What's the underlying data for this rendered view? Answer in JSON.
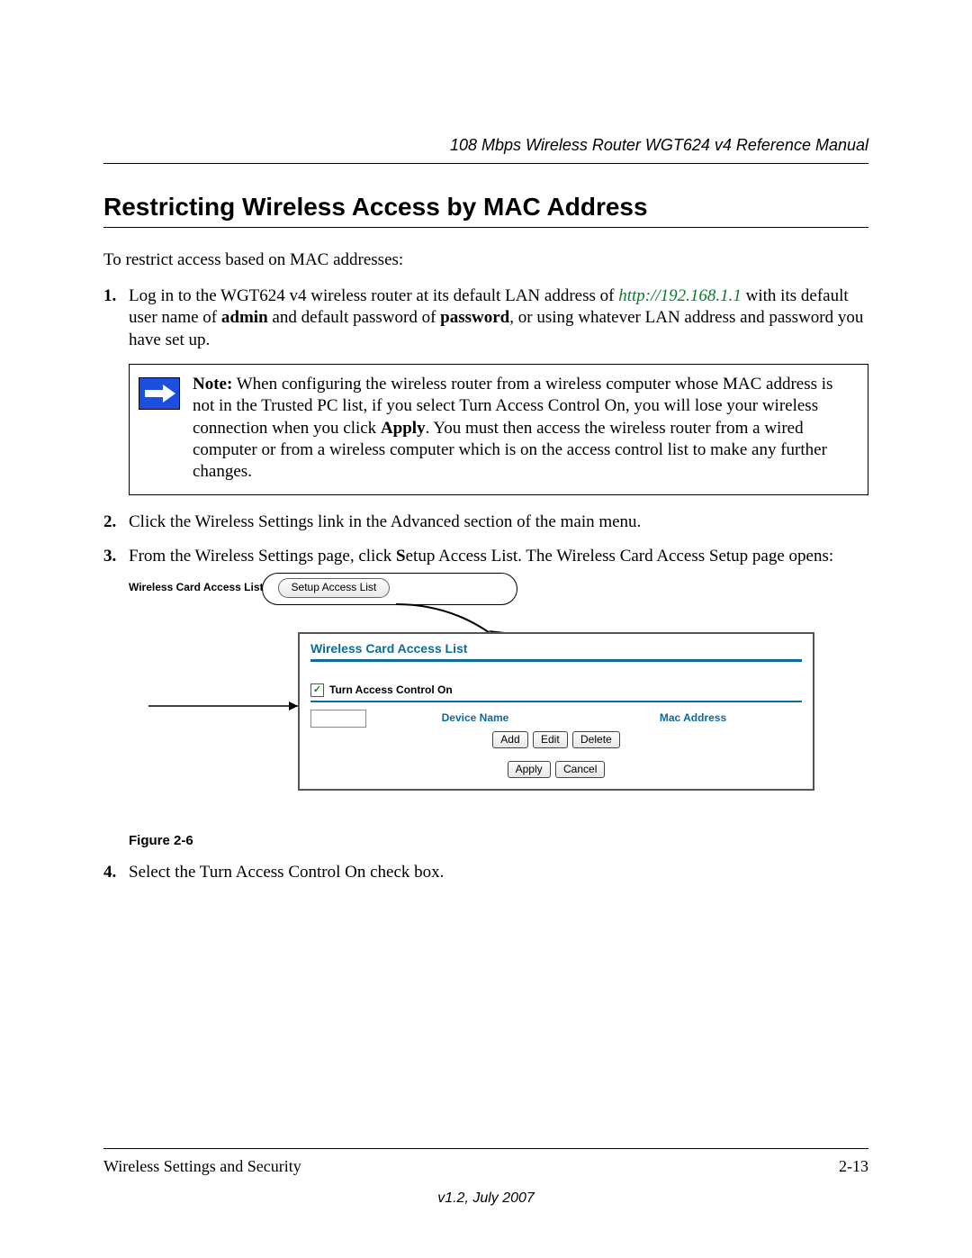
{
  "header": {
    "running_head": "108 Mbps Wireless Router WGT624 v4 Reference Manual"
  },
  "section": {
    "title": "Restricting Wireless Access by MAC Address",
    "intro": "To restrict access based on MAC addresses:"
  },
  "steps": {
    "s1": {
      "num": "1.",
      "pre": "Log in to the WGT624 v4 wireless router at its default LAN address of ",
      "link_text": "http://192.168.1.1",
      "mid1": " with its default user name of ",
      "bold1": "admin",
      "mid2": " and default password of ",
      "bold2": "password",
      "post": ", or using whatever LAN address and password you have set up."
    },
    "note": {
      "label": "Note:",
      "body_a": " When configuring the wireless router from a wireless computer whose MAC address is not in the Trusted PC list, if you select Turn Access Control On, you will lose your wireless connection when you click ",
      "apply": "Apply",
      "body_b": ". You must then access the wireless router from a wired computer or from a wireless computer which is on the access control list to make any further changes."
    },
    "s2": {
      "num": "2.",
      "text": "Click the Wireless Settings link in the Advanced section of the main menu."
    },
    "s3": {
      "num": "3.",
      "pre": "From the Wireless Settings page, click ",
      "bold_s": "S",
      "post": "etup Access List. The Wireless Card Access Setup page opens:"
    },
    "s4": {
      "num": "4.",
      "text": "Select the Turn Access Control On check box."
    }
  },
  "figure": {
    "top_label": "Wireless Card Access List",
    "setup_btn": "Setup Access List",
    "panel_title": "Wireless Card Access List",
    "checkbox_label": "Turn Access Control On",
    "col_device": "Device Name",
    "col_mac": "Mac Address",
    "btn_add": "Add",
    "btn_edit": "Edit",
    "btn_delete": "Delete",
    "btn_apply": "Apply",
    "btn_cancel": "Cancel",
    "caption": "Figure 2-6"
  },
  "footer": {
    "left": "Wireless Settings and Security",
    "right": "2-13",
    "version": "v1.2, July 2007"
  }
}
